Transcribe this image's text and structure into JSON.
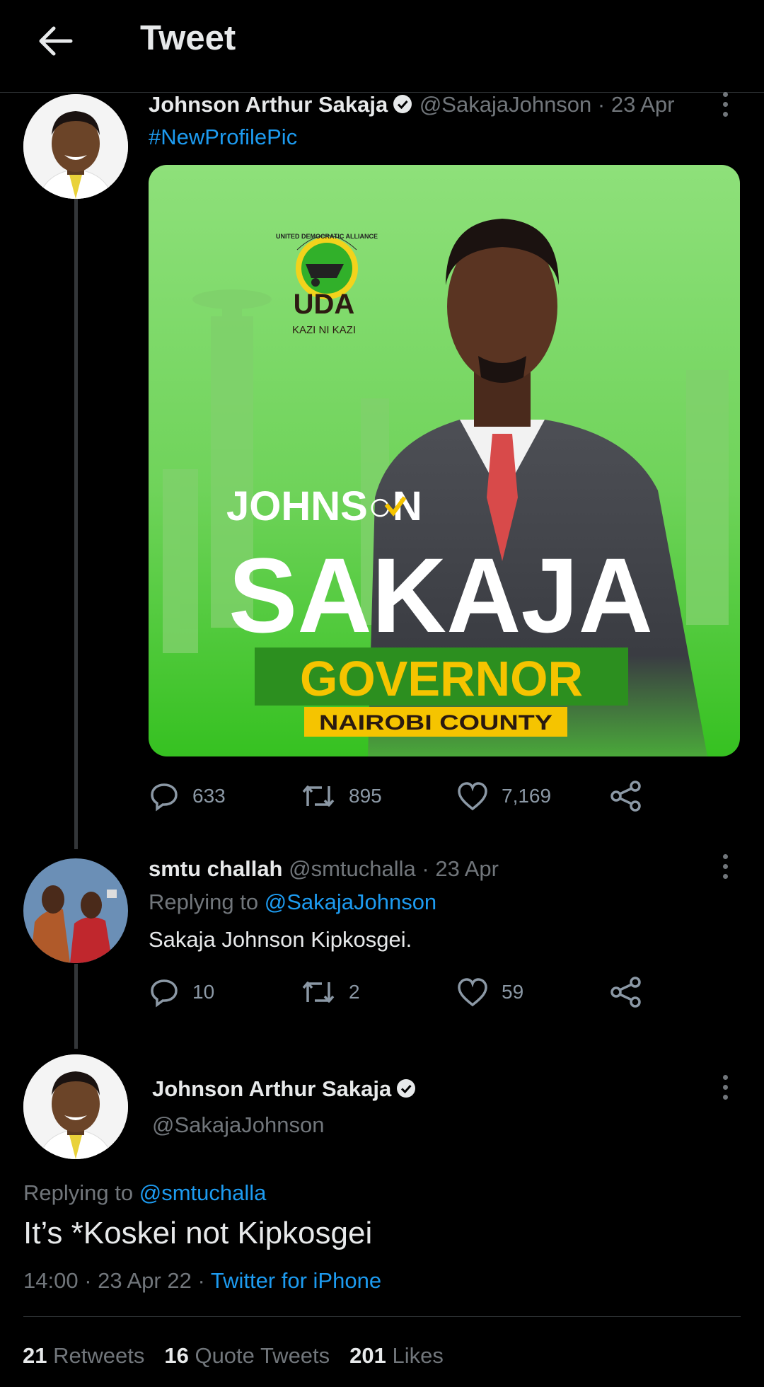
{
  "header": {
    "title": "Tweet"
  },
  "tweet1": {
    "name": "Johnson Arthur Sakaja",
    "handle": "@SakajaJohnson",
    "date": "· 23 Apr",
    "hashtag": "#NewProfilePic",
    "poster": {
      "party": "UDA",
      "slogan": "KAZI NI KAZI",
      "arc": "UNITED DEMOCRATIC ALLIANCE",
      "first": "JOHNS",
      "first_end": "N",
      "last": "SAKAJA",
      "role": "GOVERNOR",
      "county": "NAIROBI COUNTY"
    },
    "stats": {
      "replies": "633",
      "retweets": "895",
      "likes": "7,169"
    }
  },
  "tweet2": {
    "name": "smtu challah",
    "handle": "@smtuchalla",
    "date": "· 23 Apr",
    "replying_prefix": "Replying to",
    "replying_to": "@SakajaJohnson",
    "text": "Sakaja Johnson Kipkosgei.",
    "stats": {
      "replies": "10",
      "retweets": "2",
      "likes": "59"
    }
  },
  "main": {
    "name": "Johnson Arthur Sakaja",
    "handle": "@SakajaJohnson",
    "replying_prefix": "Replying to",
    "replying_to": "@smtuchalla",
    "text": "It’s *Koskei not Kipkosgei",
    "time": "14:00 · 23 Apr 22 ·",
    "source": "Twitter for iPhone",
    "retweets_count": "21",
    "retweets_label": "Retweets",
    "quotes_count": "16",
    "quotes_label": "Quote Tweets",
    "likes_count": "201",
    "likes_label": "Likes"
  },
  "icons": [
    "back-arrow-icon",
    "verified-badge-icon",
    "more-options-icon",
    "reply-icon",
    "retweet-icon",
    "like-icon",
    "share-icon"
  ],
  "colors": {
    "background": "#000000",
    "link": "#1d9bf0",
    "muted": "#71767b",
    "poster_green": "#3ec62a",
    "poster_yellow": "#f5c400"
  }
}
